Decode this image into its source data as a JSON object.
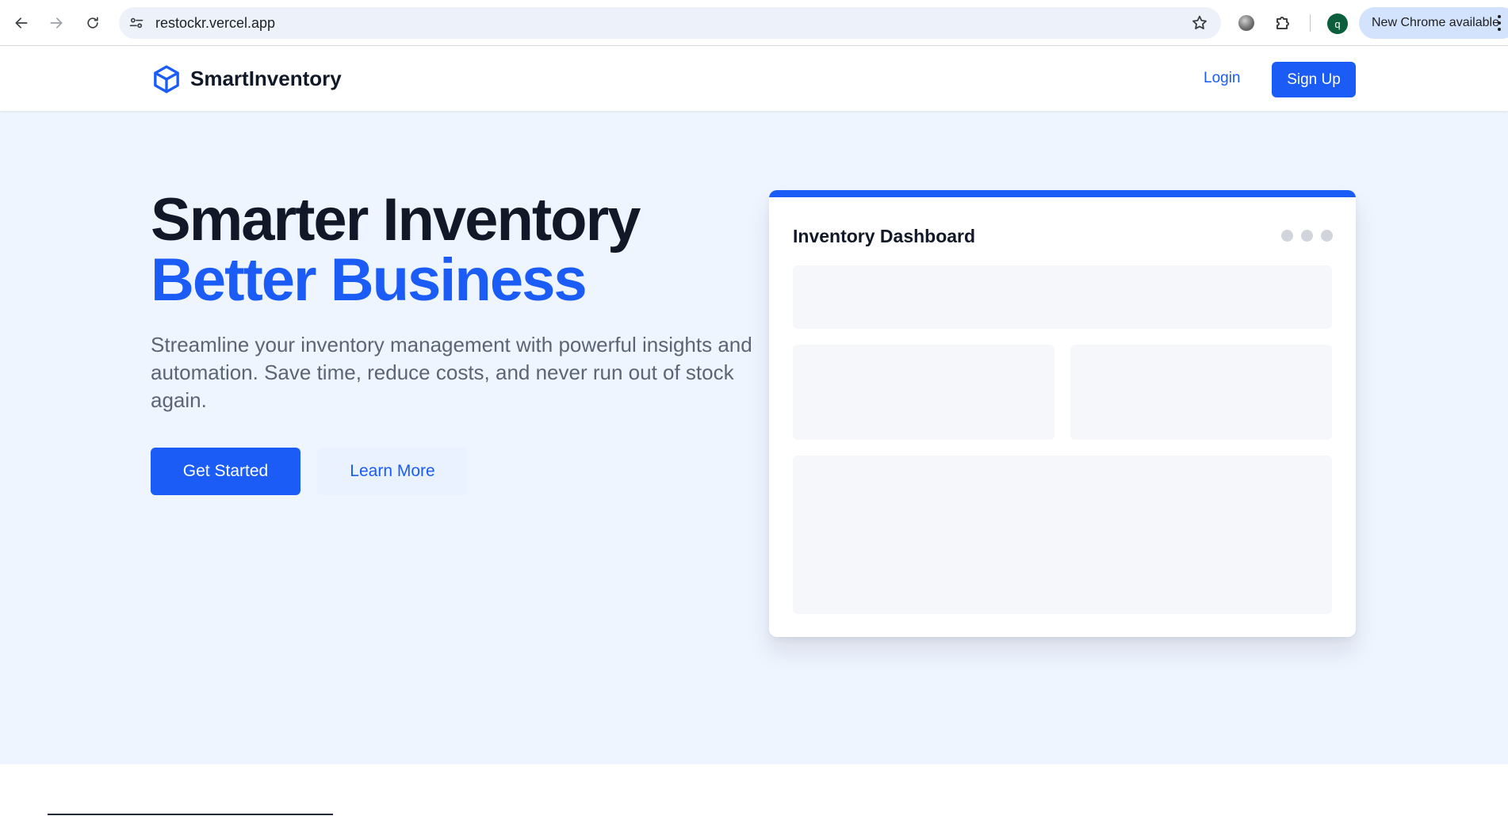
{
  "browser": {
    "url": "restockr.vercel.app",
    "update_label": "New Chrome available",
    "profile_initial": "q",
    "icons": [
      "back-icon",
      "forward-icon",
      "reload-icon",
      "site-info-icon",
      "star-icon",
      "extension-ball-icon",
      "puzzle-icon",
      "kebab-menu-icon"
    ]
  },
  "header": {
    "logo_icon": "cube-icon",
    "brand": "SmartInventory",
    "login": "Login",
    "signup": "Sign Up"
  },
  "hero": {
    "headline_line1": "Smarter Inventory",
    "headline_line2": "Better Business",
    "subtext": "Streamline your inventory management with powerful insights and automation. Save time, reduce costs, and never run out of stock again.",
    "primary_cta": "Get Started",
    "secondary_cta": "Learn More"
  },
  "dashboard_preview": {
    "title": "Inventory Dashboard"
  },
  "colors": {
    "brand_blue": "#1a5cf5",
    "hero_bg": "#eff5ff",
    "heading": "#111827",
    "body_text": "#5b6574"
  }
}
